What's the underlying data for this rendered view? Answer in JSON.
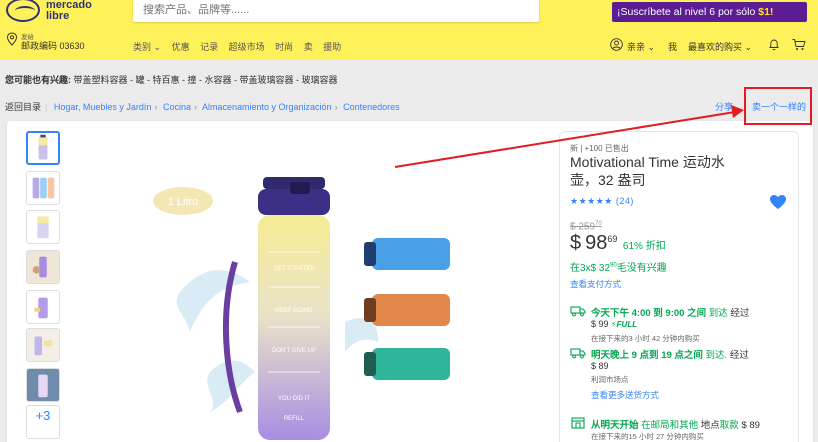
{
  "header": {
    "logo_line1": "mercado",
    "logo_line2": "libre",
    "search_placeholder": "搜索产品、品牌等......",
    "promo_text": "¡Suscríbete al nivel 6 por sólo ",
    "promo_price": "$1!",
    "location_label": "发给",
    "location_value": "邮政编码 03630",
    "nav_items": [
      "类别 ⌄",
      "优惠",
      "记录",
      "超级市场",
      "时尚",
      "卖",
      "援助"
    ],
    "user_name": "亲亲 ⌄",
    "my_label": "我",
    "purchases_label": "最喜欢的购买 ⌄"
  },
  "interest": {
    "label": "您可能也有兴趣:",
    "text": "带盖塑料容器 - 罐 - 特百惠 - 撞 - 水容器 - 带盖玻璃容器 - 玻璃容器"
  },
  "breadcrumb": {
    "back": "返回目录",
    "items": [
      "Hogar, Muebles y Jardín",
      "Cocina",
      "Almacenamiento y Organización",
      "Contenedores"
    ],
    "share": "分享",
    "sell_same": "卖一个一样的"
  },
  "product": {
    "condition": "新 | +100 已售出",
    "title": "Motivational Time 运动水壶，32 盎司",
    "rating_stars": "★★★★★",
    "rating_count": "(24)",
    "old_price": "$ 259",
    "old_price_cents": "70",
    "currency": "$",
    "price_int": "98",
    "price_cents": "69",
    "discount": "61% 折扣",
    "installments_prefix": "在3x$ 32",
    "installments_cents": "90",
    "installments_suffix": "毛没有兴趣",
    "pay_methods_link": "查看支付方式",
    "image_badge": "1 Litro",
    "bottle_labels": [
      "GET STARTED",
      "KEEP GOING",
      "DON'T GIVE UP",
      "YOU DID IT",
      "REFILL"
    ],
    "more_thumbs": "+3"
  },
  "shipping": [
    {
      "title_bold": "今天下午 4:00 到 9:00 之间",
      "title_rest": " 到达",
      "title_gray": " 经过",
      "price": "$ 99",
      "full_label": "⚡FULL",
      "note": "在接下来的3 小时 42 分钟内购买"
    },
    {
      "title_bold": "明天晚上 9 点到 19 点之间",
      "title_rest": " 到达.",
      "title_gray": " 经过",
      "price": "$ 89",
      "note": "利润市场点",
      "link": "查看更多送货方式"
    },
    {
      "title_bold": "从明天开始",
      "title_rest": " 在邮局和其他",
      "title_gray": " 地点",
      "title_rest2": "取款",
      "price": " $ 89",
      "note": "在接下来的15 小时 27 分钟内购买"
    }
  ],
  "colors": {
    "header_bg": "#fff159",
    "accent_blue": "#3483fa",
    "green": "#00a650",
    "promo_bg": "#5c1c94",
    "annotation_red": "#e31b23"
  }
}
